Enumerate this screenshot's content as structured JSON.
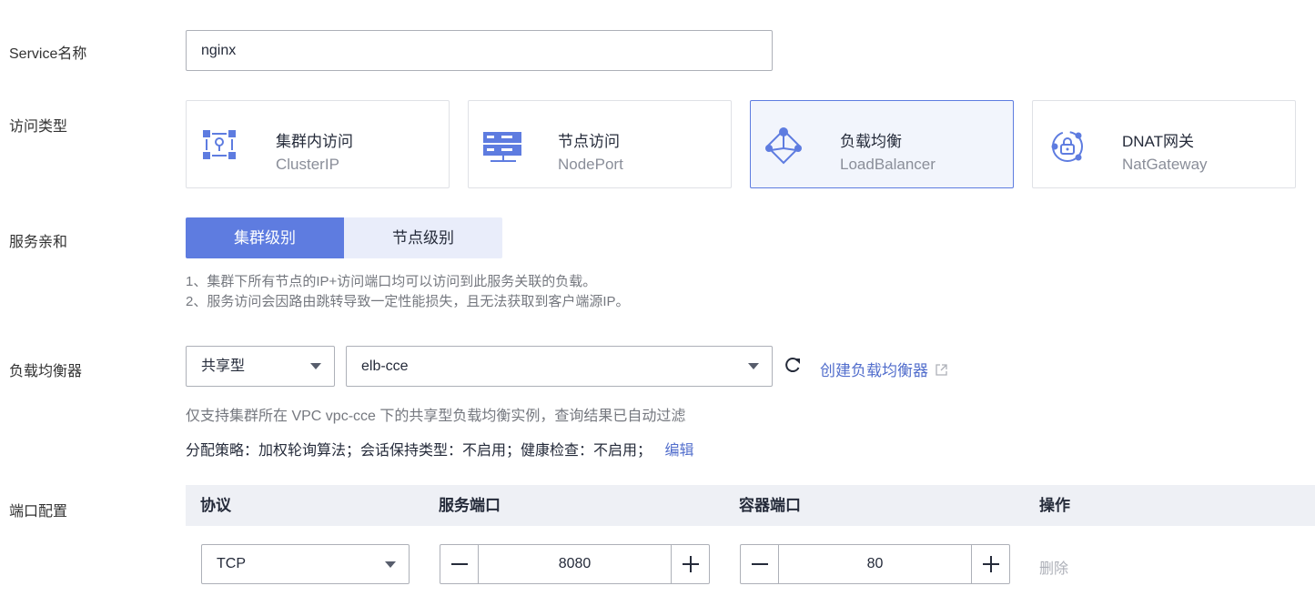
{
  "service_name": {
    "label": "Service名称",
    "value": "nginx"
  },
  "access_type": {
    "label": "访问类型",
    "options": [
      {
        "title": "集群内访问",
        "subtitle": "ClusterIP",
        "icon": "cluster-ip-icon",
        "selected": false
      },
      {
        "title": "节点访问",
        "subtitle": "NodePort",
        "icon": "node-port-icon",
        "selected": false
      },
      {
        "title": "负载均衡",
        "subtitle": "LoadBalancer",
        "icon": "load-balancer-icon",
        "selected": true
      },
      {
        "title": "DNAT网关",
        "subtitle": "NatGateway",
        "icon": "nat-gateway-icon",
        "selected": false
      }
    ]
  },
  "service_affinity": {
    "label": "服务亲和",
    "options": [
      "集群级别",
      "节点级别"
    ],
    "selected": "集群级别",
    "notes": [
      "1、集群下所有节点的IP+访问端口均可以访问到此服务关联的负载。",
      "2、服务访问会因路由跳转导致一定性能损失，且无法获取到客户端源IP。"
    ]
  },
  "load_balancer": {
    "label": "负载均衡器",
    "type_value": "共享型",
    "instance_value": "elb-cce",
    "create_link": "创建负载均衡器",
    "hint": "仅支持集群所在 VPC vpc-cce 下的共享型负载均衡实例，查询结果已自动过滤",
    "policy_text": "分配策略：加权轮询算法；会话保持类型：不启用；健康检查：不启用；",
    "edit_link": "编辑"
  },
  "port_config": {
    "label": "端口配置",
    "headers": [
      "协议",
      "服务端口",
      "容器端口",
      "操作"
    ],
    "rows": [
      {
        "protocol": "TCP",
        "service_port": "8080",
        "container_port": "80",
        "action": "删除"
      }
    ]
  },
  "colors": {
    "accent": "#5e7ce0",
    "link": "#526ecc",
    "selected_bg": "#f2f5fc"
  }
}
